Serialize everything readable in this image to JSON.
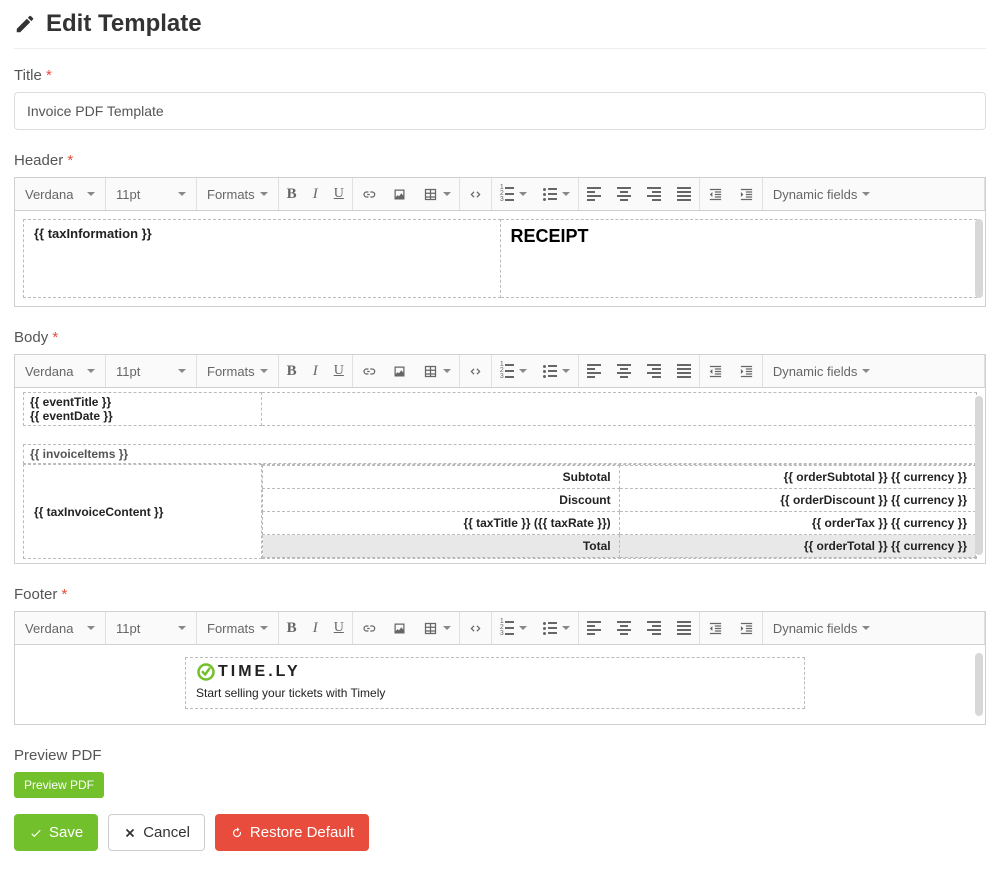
{
  "page": {
    "title": "Edit Template"
  },
  "fields": {
    "title": {
      "label": "Title",
      "required": "*",
      "value": "Invoice PDF Template"
    },
    "header": {
      "label": "Header",
      "required": "*"
    },
    "body": {
      "label": "Body",
      "required": "*"
    },
    "footer": {
      "label": "Footer",
      "required": "*"
    },
    "preview": {
      "label": "Preview PDF"
    }
  },
  "toolbar": {
    "font": "Verdana",
    "size": "11pt",
    "formats": "Formats",
    "dynamic": "Dynamic fields"
  },
  "header_content": {
    "left": "{{ taxInformation }}",
    "right": "RECEIPT"
  },
  "body_content": {
    "eventTitle": "{{ eventTitle }}",
    "eventDate": "{{ eventDate }}",
    "invoiceItems": "{{ invoiceItems }}",
    "taxInvoiceContent": "{{ taxInvoiceContent }}",
    "rows": [
      {
        "label": "Subtotal",
        "value": "{{ orderSubtotal }} {{ currency }}"
      },
      {
        "label": "Discount",
        "value": "{{ orderDiscount }} {{ currency }}"
      },
      {
        "label": "{{ taxTitle }} ({{ taxRate }})",
        "value": "{{ orderTax }} {{ currency }}"
      },
      {
        "label": "Total",
        "value": "{{ orderTotal }} {{ currency }}"
      }
    ]
  },
  "footer_content": {
    "logo_text": "TIME.LY",
    "tagline": "Start selling your tickets with Timely"
  },
  "buttons": {
    "preview": "Preview PDF",
    "save": "Save",
    "cancel": "Cancel",
    "restore": "Restore Default"
  }
}
